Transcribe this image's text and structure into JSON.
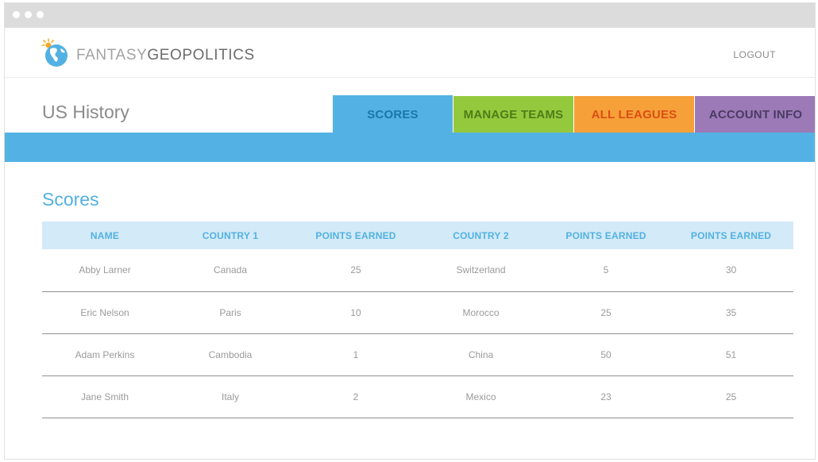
{
  "header": {
    "brand_light": "FANTASY",
    "brand_dark": "GEOPOLITICS",
    "logout_label": "LOGOUT",
    "logo_icon": "globe-sun-icon"
  },
  "league": {
    "title": "US History"
  },
  "tabs": [
    {
      "label": "SCORES",
      "color": "#53b2e3",
      "active": true
    },
    {
      "label": "MANAGE TEAMS",
      "color": "#95c93d",
      "active": false
    },
    {
      "label": "ALL LEAGUES",
      "color": "#f6a039",
      "active": false
    },
    {
      "label": "ACCOUNT INFO",
      "color": "#9b7ab7",
      "active": false
    }
  ],
  "scores": {
    "title": "Scores",
    "columns": [
      "NAME",
      "COUNTRY 1",
      "POINTS EARNED",
      "COUNTRY 2",
      "POINTS EARNED",
      "POINTS EARNED"
    ],
    "rows": [
      [
        "Abby Larner",
        "Canada",
        "25",
        "Switzerland",
        "5",
        "30"
      ],
      [
        "Eric Nelson",
        "Paris",
        "10",
        "Morocco",
        "25",
        "35"
      ],
      [
        "Adam Perkins",
        "Cambodia",
        "1",
        "China",
        "50",
        "51"
      ],
      [
        "Jane Smith",
        "Italy",
        "2",
        "Mexico",
        "23",
        "25"
      ]
    ]
  },
  "colors": {
    "accent_blue": "#53b2e3",
    "accent_green": "#95c93d",
    "accent_orange": "#f6a039",
    "accent_purple": "#9b7ab7"
  }
}
